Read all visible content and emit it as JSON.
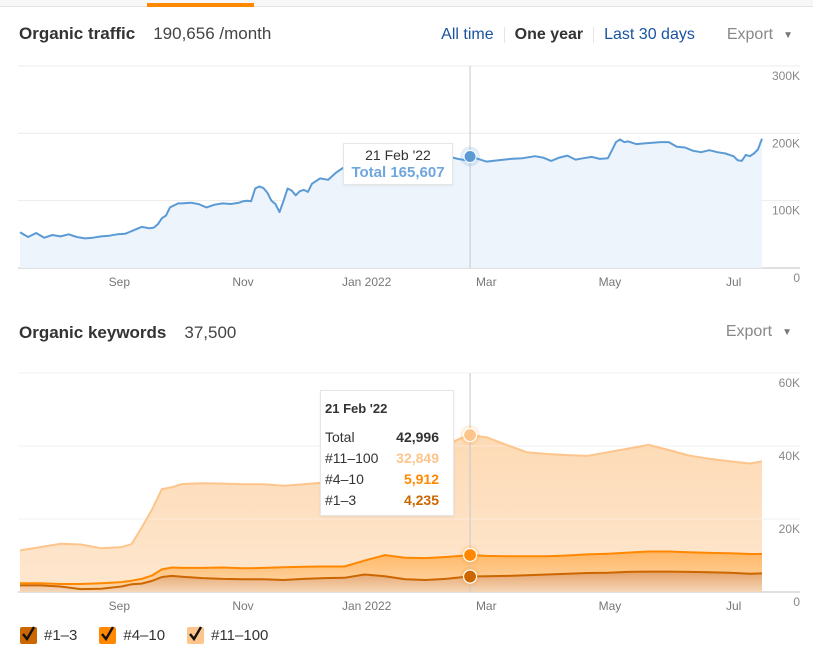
{
  "nav": {
    "active_tab_color": "#ff8800"
  },
  "traffic": {
    "title": "Organic traffic",
    "value": "190,656 /month",
    "range_tabs": [
      {
        "label": "All time",
        "active": false
      },
      {
        "label": "One year",
        "active": true
      },
      {
        "label": "Last 30 days",
        "active": false
      }
    ],
    "export_label": "Export",
    "tooltip": {
      "date": "21 Feb '22",
      "label": "Total 165,607"
    }
  },
  "keywords": {
    "title": "Organic keywords",
    "value": "37,500",
    "export_label": "Export",
    "tooltip": {
      "date": "21 Feb '22",
      "rows": [
        {
          "label": "Total",
          "value": "42,996",
          "color": "#333333"
        },
        {
          "label": "#11–100",
          "value": "32,849",
          "color": "#fdc58c"
        },
        {
          "label": "#4–10",
          "value": "5,912",
          "color": "#ff8800"
        },
        {
          "label": "#1–3",
          "value": "4,235",
          "color": "#cc6600"
        }
      ]
    },
    "legend": [
      {
        "label": "#1–3",
        "color": "#cc6600",
        "checked": true
      },
      {
        "label": "#4–10",
        "color": "#ff8800",
        "checked": true
      },
      {
        "label": "#11–100",
        "color": "#fdc58c",
        "checked": true
      }
    ]
  },
  "chart_data": [
    {
      "type": "area",
      "title": "Organic traffic",
      "xlabel": "",
      "ylabel": "",
      "x_tick_labels": [
        "Sep",
        "Nov",
        "Jan 2022",
        "Mar",
        "May",
        "Jul"
      ],
      "x_tick_days": [
        49,
        110,
        171,
        230,
        291,
        352
      ],
      "y_tick_labels": [
        "300K",
        "200K",
        "100K",
        "0"
      ],
      "ylim": [
        0,
        300000
      ],
      "x_range_days": [
        0,
        366
      ],
      "grid": true,
      "color": "#5b9bd5",
      "fill": "#eef4fc",
      "crosshair_day": 222,
      "series": [
        {
          "name": "Total",
          "x": [
            0,
            4,
            8,
            12,
            16,
            20,
            24,
            28,
            32,
            36,
            40,
            44,
            48,
            52,
            56,
            60,
            64,
            66,
            68,
            70,
            72,
            74,
            76,
            78,
            80,
            84,
            88,
            92,
            96,
            100,
            104,
            108,
            110,
            112,
            114,
            116,
            118,
            120,
            122,
            124,
            126,
            128,
            130,
            132,
            134,
            136,
            138,
            140,
            142,
            144,
            148,
            152,
            156,
            160,
            164,
            168,
            172,
            176,
            180,
            184,
            188,
            192,
            196,
            200,
            204,
            208,
            212,
            216,
            220,
            222,
            226,
            230,
            236,
            242,
            248,
            254,
            258,
            262,
            266,
            270,
            274,
            278,
            282,
            286,
            290,
            292,
            294,
            296,
            298,
            300,
            304,
            308,
            312,
            316,
            320,
            324,
            328,
            332,
            336,
            340,
            344,
            348,
            350,
            352,
            354,
            356,
            358,
            360,
            362,
            364,
            366
          ],
          "y": [
            53000,
            46000,
            52000,
            45000,
            49000,
            47000,
            50000,
            46000,
            44000,
            45000,
            47000,
            48000,
            50000,
            51000,
            56000,
            61000,
            59000,
            60000,
            65000,
            74000,
            78000,
            90000,
            93000,
            96000,
            96000,
            97000,
            95000,
            90000,
            94000,
            96000,
            95000,
            97000,
            99000,
            100000,
            99000,
            118000,
            121000,
            119000,
            112000,
            100000,
            95000,
            83000,
            100000,
            118000,
            115000,
            108000,
            114000,
            116000,
            113000,
            125000,
            133000,
            131000,
            142000,
            150000,
            156000,
            157000,
            156000,
            163000,
            164000,
            162000,
            161000,
            163000,
            164000,
            161000,
            163000,
            166000,
            165000,
            162000,
            160000,
            165607,
            162000,
            158000,
            160000,
            162000,
            163000,
            166000,
            164000,
            159000,
            164000,
            167000,
            161000,
            163000,
            165000,
            162000,
            163000,
            175000,
            187000,
            191000,
            187000,
            188000,
            184000,
            185000,
            186000,
            187000,
            187000,
            180000,
            179000,
            174000,
            172000,
            175000,
            172000,
            170000,
            168000,
            166000,
            160000,
            159000,
            168000,
            166000,
            170000,
            176000,
            192000
          ]
        }
      ]
    },
    {
      "type": "area",
      "title": "Organic keywords",
      "xlabel": "",
      "ylabel": "",
      "stacked": true,
      "x_tick_labels": [
        "Sep",
        "Nov",
        "Jan 2022",
        "Mar",
        "May",
        "Jul"
      ],
      "x_tick_days": [
        49,
        110,
        171,
        230,
        291,
        352
      ],
      "y_tick_labels": [
        "60K",
        "40K",
        "20K",
        "0"
      ],
      "ylim": [
        0,
        60000
      ],
      "x_range_days": [
        0,
        366
      ],
      "grid": true,
      "crosshair_day": 222,
      "x": [
        0,
        10,
        20,
        30,
        40,
        50,
        55,
        60,
        65,
        70,
        75,
        80,
        90,
        100,
        110,
        120,
        130,
        140,
        150,
        160,
        170,
        180,
        190,
        200,
        210,
        220,
        222,
        230,
        240,
        250,
        260,
        270,
        280,
        290,
        300,
        310,
        320,
        330,
        340,
        350,
        360,
        366
      ],
      "series": [
        {
          "name": "#1–3",
          "color": "#cc6600",
          "values": [
            1800,
            1800,
            1500,
            800,
            900,
            1500,
            2100,
            2300,
            3000,
            4100,
            4400,
            4200,
            3800,
            3600,
            3500,
            3500,
            3300,
            3600,
            3800,
            3900,
            4800,
            4300,
            3500,
            3300,
            3600,
            4200,
            4235,
            4300,
            4400,
            4600,
            4800,
            5000,
            5200,
            5300,
            5500,
            5600,
            5600,
            5500,
            5400,
            5300,
            5000,
            5100
          ]
        },
        {
          "name": "#4–10",
          "color": "#ff8800",
          "values": [
            600,
            600,
            700,
            1400,
            1500,
            1200,
            1000,
            1300,
            1500,
            2100,
            2300,
            2400,
            2800,
            3100,
            3000,
            3100,
            3500,
            3300,
            3200,
            3100,
            3800,
            5800,
            5900,
            6000,
            6000,
            5800,
            5912,
            5600,
            5400,
            5200,
            5000,
            5000,
            5100,
            5200,
            5300,
            5500,
            5500,
            5400,
            5300,
            5300,
            5400,
            5300
          ]
        },
        {
          "name": "#11–100",
          "color": "#fdc58c",
          "values": [
            9000,
            9900,
            11000,
            10800,
            9600,
            9600,
            10000,
            14000,
            18000,
            22000,
            22000,
            23000,
            23200,
            23000,
            23000,
            22900,
            22300,
            22600,
            23000,
            23800,
            24400,
            26700,
            30000,
            30700,
            30700,
            32700,
            32849,
            32500,
            30500,
            28500,
            28000,
            27500,
            27000,
            27800,
            28500,
            29200,
            27800,
            26500,
            25800,
            25200,
            24800,
            25400
          ]
        }
      ],
      "totals_at_crosshair": 42996
    }
  ]
}
